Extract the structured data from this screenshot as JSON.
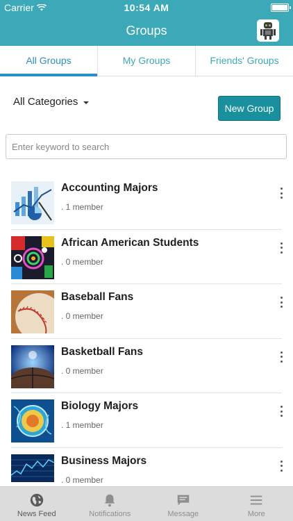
{
  "status_bar": {
    "carrier": "Carrier",
    "time": "10:54 AM"
  },
  "header": {
    "title": "Groups"
  },
  "tabs": [
    {
      "label": "All Groups",
      "active": true
    },
    {
      "label": "My Groups",
      "active": false
    },
    {
      "label": "Friends' Groups",
      "active": false
    }
  ],
  "filter": {
    "category_label": "All Categories",
    "new_group_label": "New Group"
  },
  "search": {
    "placeholder": "Enter keyword to search"
  },
  "groups": [
    {
      "name": "Accounting Majors",
      "members": ". 1 member",
      "thumb": "chart-icon"
    },
    {
      "name": "African American Students",
      "members": ". 0 member",
      "thumb": "art-icon"
    },
    {
      "name": "Baseball Fans",
      "members": ". 0 member",
      "thumb": "baseball-icon"
    },
    {
      "name": "Basketball Fans",
      "members": ". 0 member",
      "thumb": "basketball-icon"
    },
    {
      "name": "Biology Majors",
      "members": ". 1 member",
      "thumb": "cell-icon"
    },
    {
      "name": "Business Majors",
      "members": ". 0 member",
      "thumb": "market-icon"
    }
  ],
  "bottom_nav": [
    {
      "label": "News Feed",
      "icon": "globe-icon"
    },
    {
      "label": "Notifications",
      "icon": "bell-icon"
    },
    {
      "label": "Message",
      "icon": "chat-icon"
    },
    {
      "label": "More",
      "icon": "menu-icon"
    }
  ],
  "colors": {
    "header": "#3ba9b7",
    "accent": "#2a8fc8",
    "button": "#18909e"
  }
}
